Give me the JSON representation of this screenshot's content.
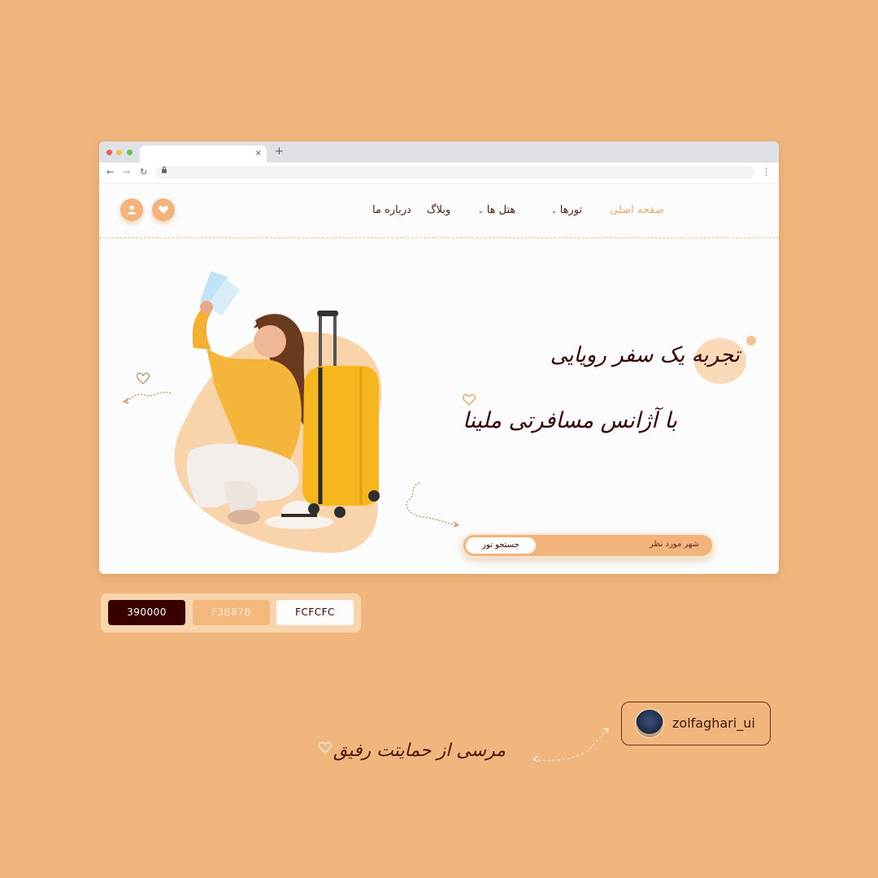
{
  "colors": {
    "background": "#f1b67d",
    "accent": "#f3b47c",
    "dark": "#390000",
    "light": "#fcfcfc"
  },
  "browser": {
    "tab_close": "×",
    "new_tab": "+",
    "back": "←",
    "forward": "→",
    "reload": "↻",
    "menu": "⋮"
  },
  "header": {
    "nav": {
      "home": "صفحه اصلی",
      "tours": "تورها",
      "hotels": "هتل ها",
      "blog": "وبلاگ",
      "about": "درباره ما"
    },
    "icons": {
      "favorites": "heart-icon",
      "account": "user-icon"
    }
  },
  "hero": {
    "line1": "تجربه یک سفر رویایی",
    "line2": "با آژانس مسافرتی ملینا",
    "search_placeholder": "شهر مورد نظر",
    "search_button": "جستجو تور"
  },
  "palette": [
    {
      "label": "390000",
      "hex": "#390000",
      "text_color": "#ffffff"
    },
    {
      "label": "F3B87B",
      "hex": "#f3b87b",
      "text_color": "#f8e3cc"
    },
    {
      "label": "FCFCFC",
      "hex": "#fcfcfc",
      "text_color": "#390000"
    }
  ],
  "footer": {
    "instagram_handle": "zolfaghari_ui",
    "thanks_text": "مرسی از حمایتت رفیق"
  }
}
